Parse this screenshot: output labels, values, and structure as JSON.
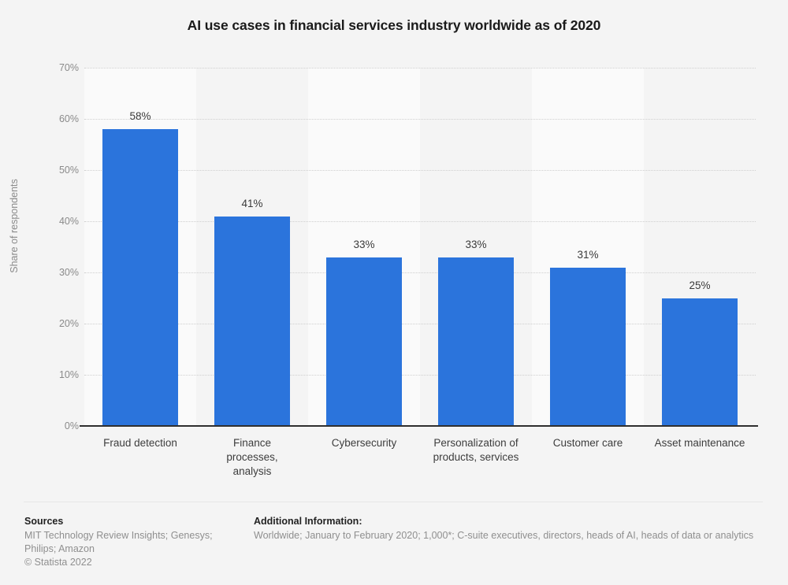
{
  "title": "AI use cases in financial services industry worldwide as of 2020",
  "axis": {
    "y_title": "Share of respondents",
    "y_ticks": [
      "0%",
      "10%",
      "20%",
      "30%",
      "40%",
      "50%",
      "60%",
      "70%"
    ]
  },
  "footer": {
    "sources_heading": "Sources",
    "sources_body": "MIT Technology Review Insights; Genesys; Philips; Amazon",
    "copyright": "© Statista 2022",
    "additional_heading": "Additional Information:",
    "additional_body": "Worldwide; January to February 2020; 1,000*; C-suite executives, directors, heads of AI, heads of data or analytics"
  },
  "colors": {
    "bar": "#2b74dc",
    "background": "#f4f4f4",
    "stripe": "#fafafa",
    "gridline": "#cfcfcf",
    "axis": "#2f2f2f"
  },
  "chart_data": {
    "type": "bar",
    "title": "AI use cases in financial services industry worldwide as of 2020",
    "xlabel": "",
    "ylabel": "Share of respondents",
    "ylim": [
      0,
      70
    ],
    "ytick_step": 10,
    "grid": true,
    "legend": null,
    "unit": "%",
    "categories": [
      "Fraud detection",
      "Finance processes, analysis",
      "Cybersecurity",
      "Personalization of products, services",
      "Customer care",
      "Asset maintenance"
    ],
    "category_lines": [
      [
        "Fraud detection"
      ],
      [
        "Finance",
        "processes,",
        "analysis"
      ],
      [
        "Cybersecurity"
      ],
      [
        "Personalization of",
        "products, services"
      ],
      [
        "Customer care"
      ],
      [
        "Asset maintenance"
      ]
    ],
    "values": [
      58,
      41,
      33,
      33,
      31,
      25
    ],
    "value_labels": [
      "58%",
      "41%",
      "33%",
      "33%",
      "31%",
      "25%"
    ]
  }
}
